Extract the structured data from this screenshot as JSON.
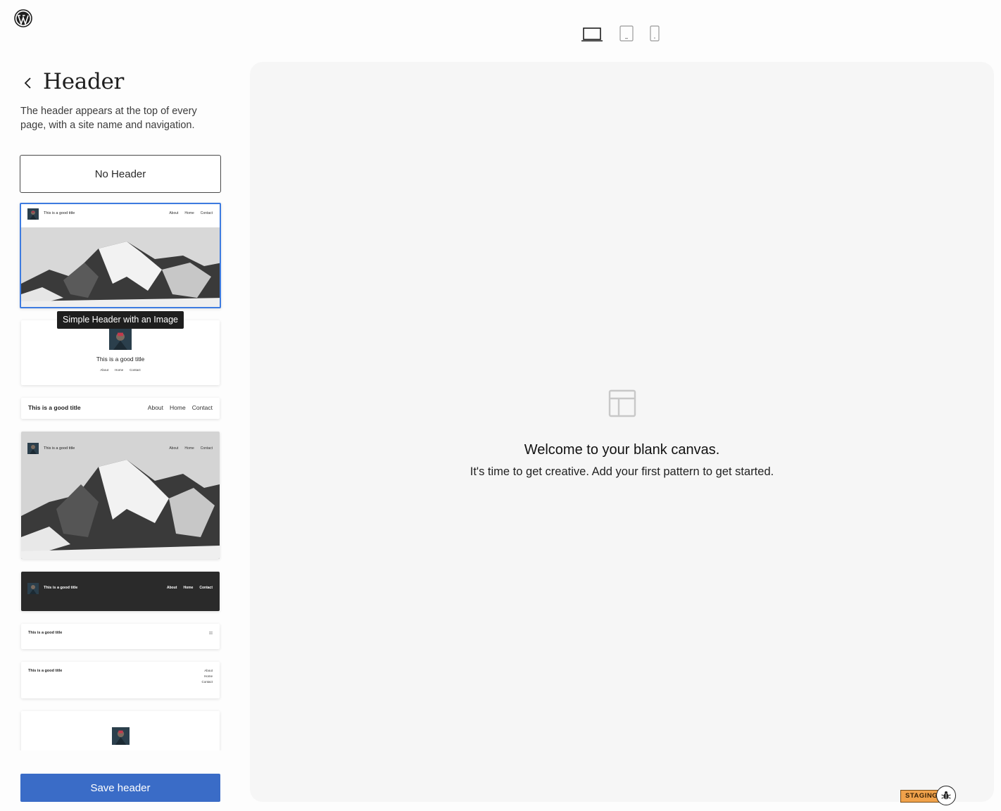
{
  "top_bar": {
    "logo_icon": "wordpress-logo-icon",
    "devices": [
      {
        "name": "desktop-icon",
        "active": true
      },
      {
        "name": "tablet-icon",
        "active": false
      },
      {
        "name": "mobile-icon",
        "active": false
      }
    ]
  },
  "sidebar": {
    "title": "Header",
    "description": "The header appears at the top of every page, with a site name and navigation.",
    "no_header_label": "No Header",
    "tooltip": "Simple Header with an Image",
    "save_label": "Save header"
  },
  "patterns": {
    "site_title": "This is a good title",
    "nav": [
      "About",
      "Home",
      "Contact"
    ],
    "selected_index": 0
  },
  "canvas": {
    "heading": "Welcome to your blank canvas.",
    "subheading": "It's time to get creative. Add your first pattern to get started."
  },
  "footer": {
    "staging_label": "STAGING",
    "bug_icon": "bug-icon"
  },
  "colors": {
    "accent": "#3858e9",
    "selected_border": "#3d7be0",
    "dark_header": "#2a2a2a",
    "staging": "#f0a24b"
  }
}
